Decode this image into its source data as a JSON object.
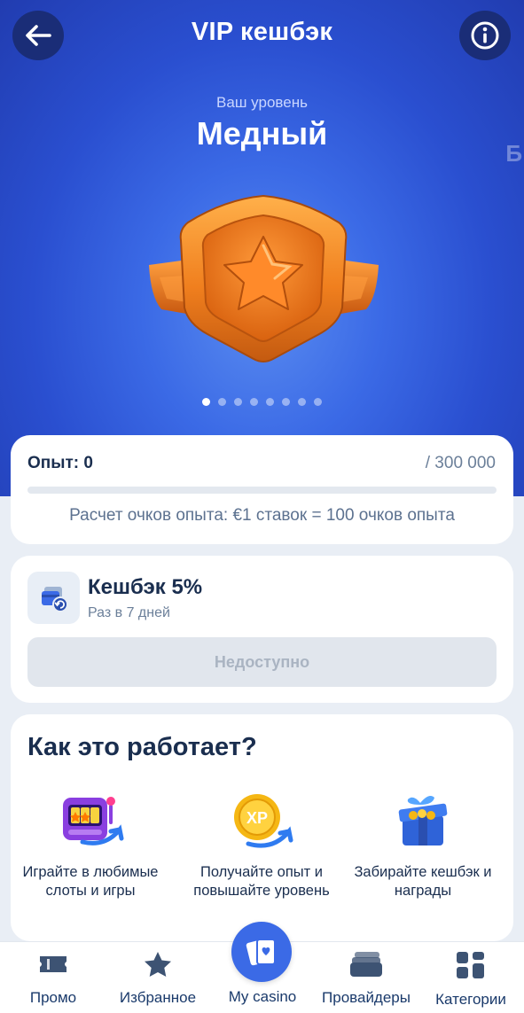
{
  "header": {
    "title": "VIP кешбэк",
    "back_icon": "arrow-left-icon",
    "info_icon": "info-icon"
  },
  "level": {
    "caption": "Ваш уровень",
    "name": "Медный",
    "next_peek": "Б",
    "badge_icon": "copper-star-shield-icon",
    "carousel_total": 8,
    "carousel_active": 1
  },
  "experience": {
    "label": "Опыт: 0",
    "max": "/ 300 000",
    "progress_fraction": 0,
    "note": "Расчет очков опыта: €1 ставок = 100 очков опыта"
  },
  "cashback": {
    "icon": "cashback-cards-icon",
    "title": "Кешбэк 5%",
    "subtitle": "Раз в 7 дней",
    "button_label": "Недоступно"
  },
  "how_it_works": {
    "title": "Как это работает?",
    "steps": [
      {
        "icon": "slot-machine-icon",
        "text": "Играйте в любимые слоты и игры"
      },
      {
        "icon": "xp-coin-icon",
        "text": "Получайте опыт и повышайте уровень"
      },
      {
        "icon": "gift-box-icon",
        "text": "Забирайте кешбэк и награды"
      }
    ]
  },
  "bottom_nav": {
    "items": [
      {
        "icon": "ticket-icon",
        "label": "Промо"
      },
      {
        "icon": "star-icon",
        "label": "Избранное"
      },
      {
        "icon": "cards-icon",
        "label": "My casino"
      },
      {
        "icon": "wallet-stack-icon",
        "label": "Провайдеры"
      },
      {
        "icon": "grid-icon",
        "label": "Категории"
      }
    ]
  },
  "colors": {
    "hero_blue": "#2a4fd0",
    "accent": "#3b6ae6",
    "text_dark": "#1a2e4f",
    "copper": "#f07f1e"
  }
}
